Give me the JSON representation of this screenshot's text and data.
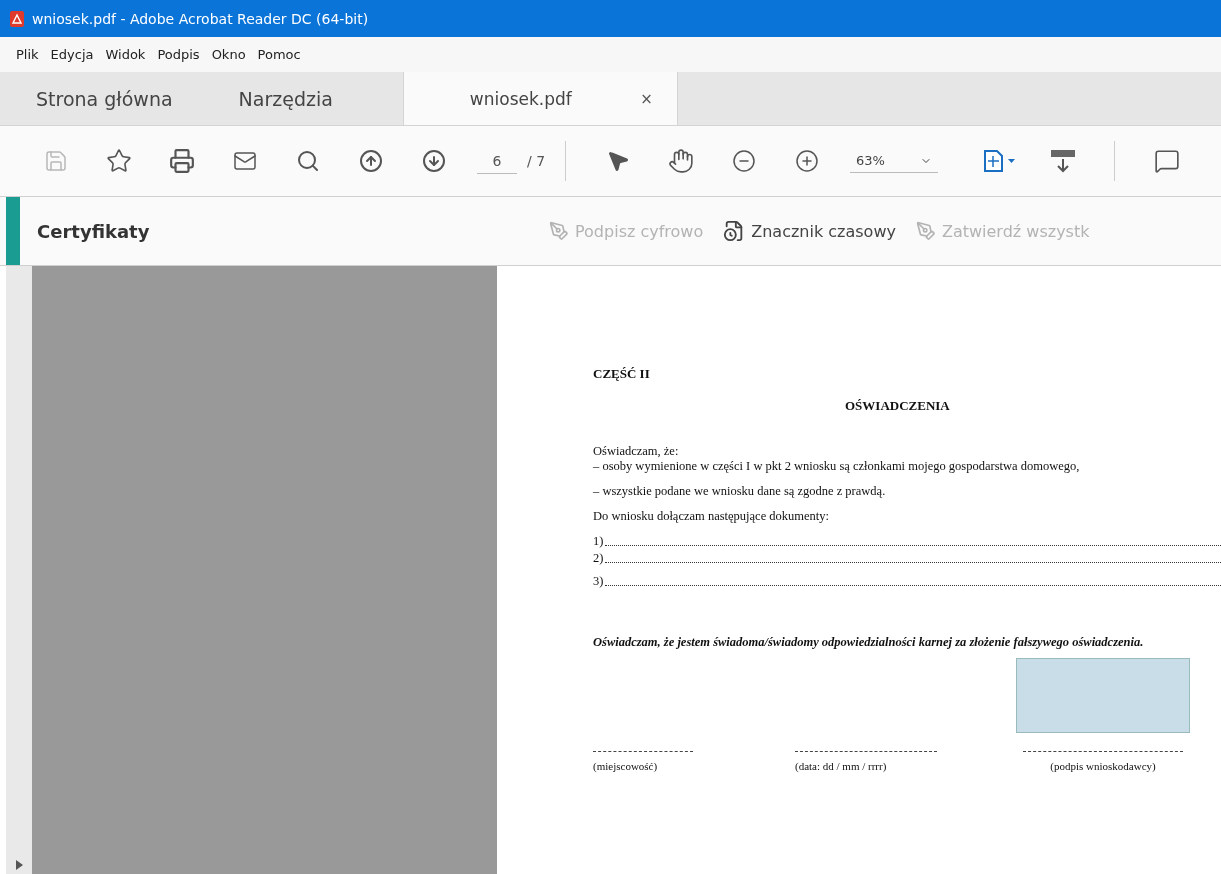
{
  "window": {
    "title": "wniosek.pdf - Adobe Acrobat Reader DC (64-bit)"
  },
  "menu": [
    "Plik",
    "Edycja",
    "Widok",
    "Podpis",
    "Okno",
    "Pomoc"
  ],
  "tabs": [
    {
      "label": "Strona główna",
      "selected": false
    },
    {
      "label": "Narzędzia",
      "selected": false
    },
    {
      "label": "wniosek.pdf",
      "selected": true,
      "close": "×"
    }
  ],
  "toolbar": {
    "save": {
      "disabled": true
    },
    "page_current": "6",
    "page_total": "/ 7",
    "zoom": "63%"
  },
  "certificates": {
    "title": "Certyfikaty",
    "actions": [
      {
        "label": "Podpisz cyfrowo",
        "disabled": true,
        "kind": "sign"
      },
      {
        "label": "Znacznik czasowy",
        "disabled": false,
        "kind": "timestamp"
      },
      {
        "label": "Zatwierdź wszystk",
        "disabled": true,
        "kind": "validate"
      }
    ]
  },
  "document": {
    "part": "CZĘŚĆ II",
    "title": "OŚWIADCZENIA",
    "intro": "Oświadczam, że:",
    "declarations": [
      "– osoby wymienione w części I w pkt 2 wniosku są członkami mojego gospodarstwa domowego,",
      "– wszystkie podane we wniosku dane są zgodne z prawdą."
    ],
    "attachments_intro": "Do wniosku dołączam następujące dokumenty:",
    "attachments": [
      "1)",
      "2)",
      "3)"
    ],
    "statement": "Oświadczam, że jestem świadoma/świadomy odpowiedzialności karnej za złożenie fałszywego oświadczenia.",
    "signatures": [
      {
        "label": "(miejscowość)",
        "kind": "place"
      },
      {
        "label": "(data: dd / mm / rrrr)",
        "kind": "date"
      },
      {
        "label": "(podpis wnioskodawcy)",
        "kind": "signature"
      }
    ]
  }
}
